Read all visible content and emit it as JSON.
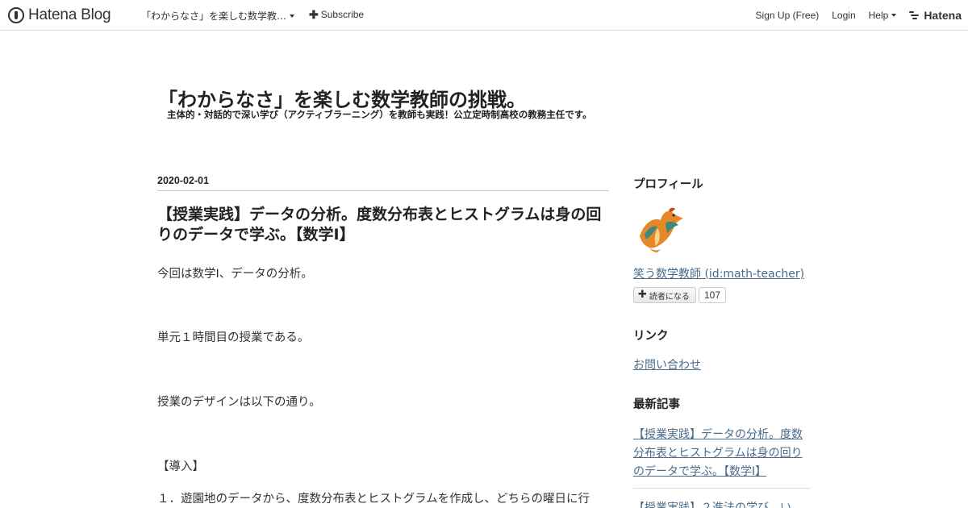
{
  "header": {
    "logo_text": "Hatena Blog",
    "blog_menu_label": "「わからなさ」を楽しむ数学教…",
    "subscribe_label": "Subscribe",
    "signup_label": "Sign Up (Free)",
    "login_label": "Login",
    "help_label": "Help",
    "hatena_label": "Hatena"
  },
  "blog": {
    "title": "「わからなさ」を楽しむ数学教師の挑戦。",
    "description": "主体的・対話的で深い学び（アクティブラーニング）を教師も実践！公立定時制高校の教務主任です。"
  },
  "entry": {
    "date": "2020-02-01",
    "title": "【授業実践】データの分析。度数分布表とヒストグラムは身の回りのデータで学ぶ。【数学Ⅰ】",
    "paragraphs": [
      "今回は数学Ⅰ、データの分析。",
      "単元１時間目の授業である。",
      "授業のデザインは以下の通り。",
      "【導入】",
      "１．遊園地のデータから、度数分布表とヒストグラムを作成し、どちらの曜日に行"
    ]
  },
  "sidebar": {
    "profile_heading": "プロフィール",
    "profile_name": "笑う数学教師 (id:math-teacher)",
    "reader_button_label": "読者になる",
    "reader_count": "107",
    "links_heading": "リンク",
    "contact_link": "お問い合わせ",
    "recent_heading": "最新記事",
    "recent_posts": [
      "【授業実践】データの分析。度数分布表とヒストグラムは身の回りのデータで学ぶ。【数学Ⅰ】",
      "【授業実践】２進法の学び、い"
    ]
  },
  "icons": {
    "logo": "hatena-blog-logo-icon",
    "subscribe": "plus-icon",
    "dropdown": "caret-down-icon",
    "hatena": "hatena-mark-icon",
    "avatar": "dragon-avatar-image"
  }
}
